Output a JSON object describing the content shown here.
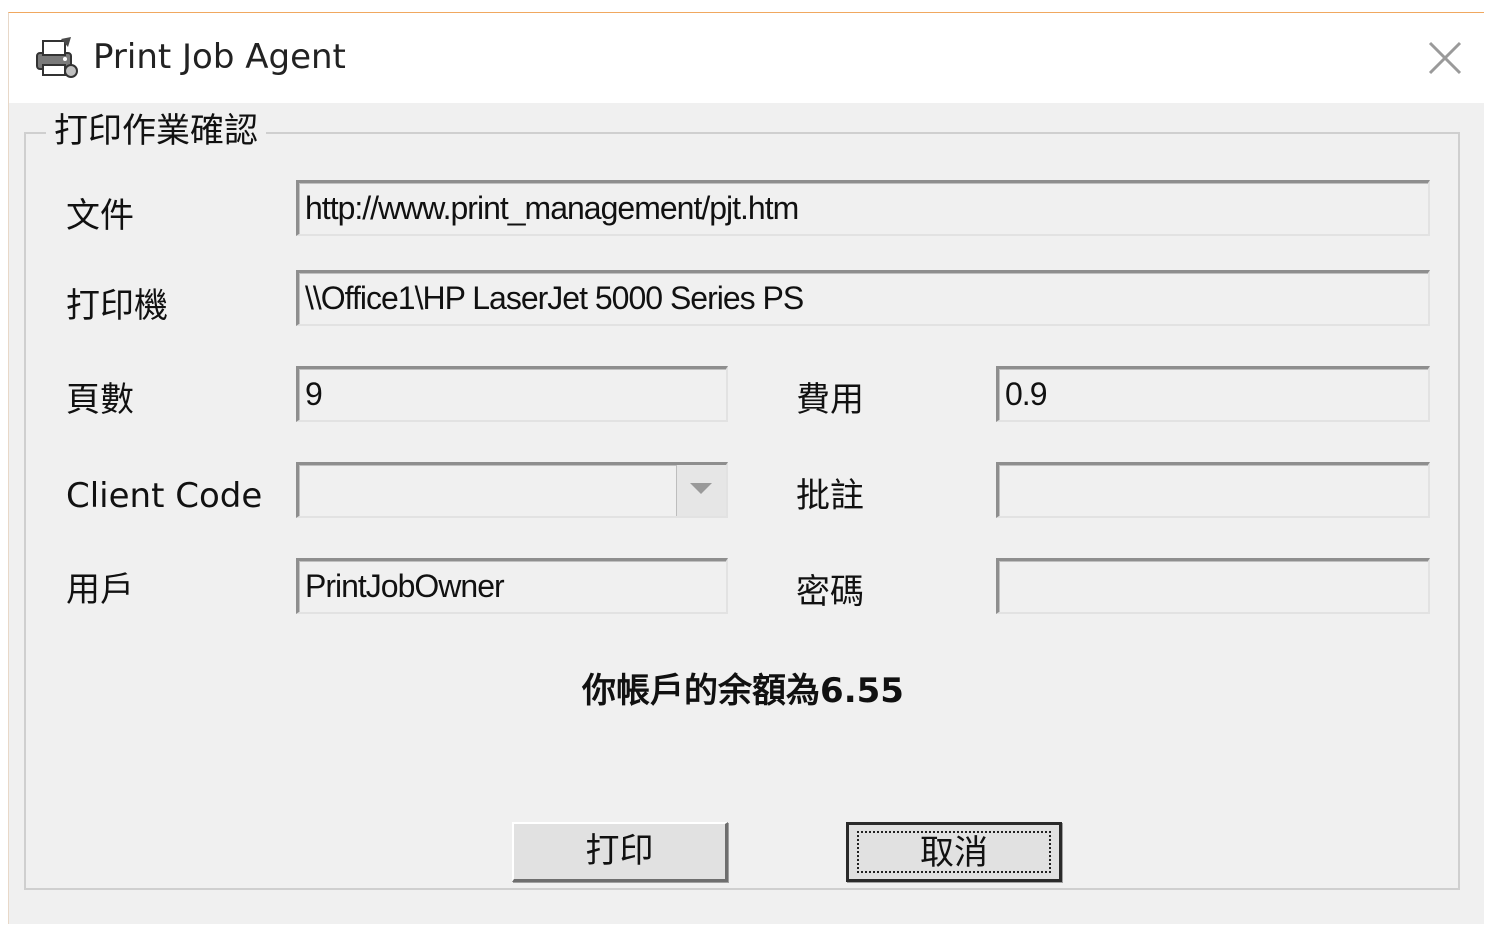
{
  "window": {
    "title": "Print Job Agent",
    "icon": "printer-agent-icon",
    "close_icon": "close-icon"
  },
  "group": {
    "title": "打印作業確認"
  },
  "fields": {
    "document": {
      "label": "文件",
      "value": "http://www.print_management/pjt.htm"
    },
    "printer": {
      "label": "打印機",
      "value": "\\\\Office1\\HP LaserJet 5000 Series PS"
    },
    "pages": {
      "label": "頁數",
      "value": "9"
    },
    "cost": {
      "label": "費用",
      "value": "0.9"
    },
    "client_code": {
      "label": "Client Code",
      "value": ""
    },
    "comment": {
      "label": "批註",
      "value": ""
    },
    "user": {
      "label": "用戶",
      "value": "PrintJobOwner"
    },
    "password": {
      "label": "密碼",
      "value": ""
    }
  },
  "balance_text": "你帳戶的余額為6.55",
  "buttons": {
    "print": "打印",
    "cancel": "取消"
  }
}
